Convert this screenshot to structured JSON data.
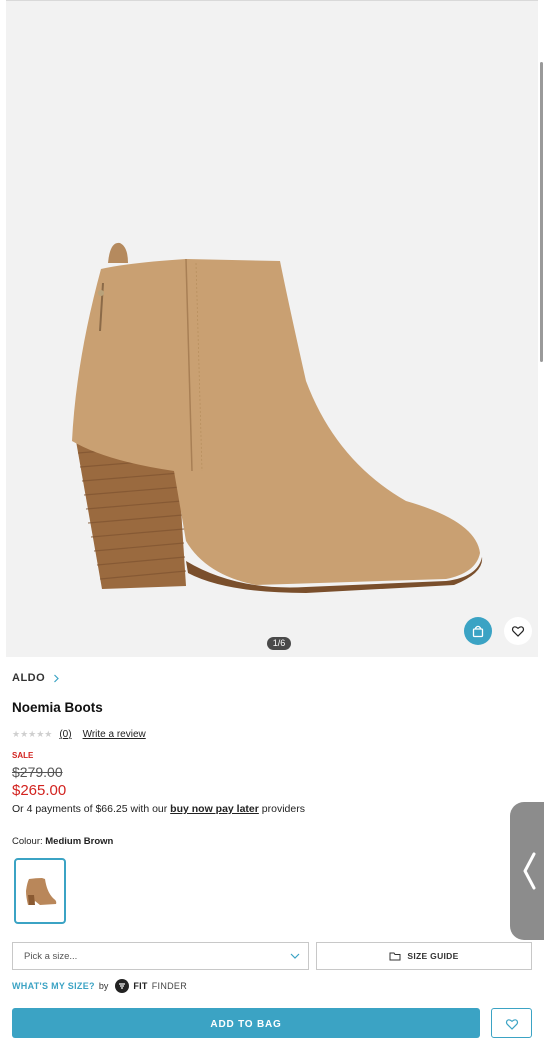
{
  "gallery": {
    "counter": "1/6",
    "image_alt": "Noemia Boots product image"
  },
  "product": {
    "brand": "ALDO",
    "title": "Noemia Boots",
    "review_count": "(0)",
    "write_review": "Write a review",
    "rating": 0,
    "sale_label": "SALE",
    "old_price": "$279.00",
    "new_price": "$265.00",
    "payments_prefix": "Or 4 payments of $66.25 with our",
    "payments_link": "buy now pay later",
    "payments_suffix": "providers"
  },
  "colour": {
    "label": "Colour:",
    "value": "Medium Brown"
  },
  "size": {
    "placeholder": "Pick a size...",
    "guide_label": "SIZE GUIDE"
  },
  "fit_finder": {
    "question": "WHAT'S MY SIZE?",
    "by": "by",
    "brand_bold": "FIT",
    "brand_light": "FINDER"
  },
  "cta": {
    "add_to_bag": "ADD TO BAG"
  },
  "colors": {
    "accent": "#3ba3c4",
    "sale": "#d2231f"
  }
}
